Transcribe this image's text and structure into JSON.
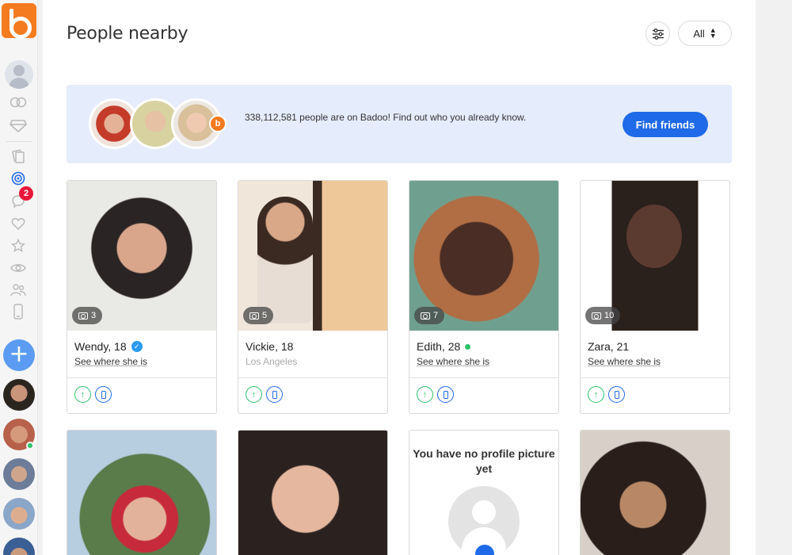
{
  "app": {
    "name": "Badoo"
  },
  "sidebar": {
    "icons": [
      "profile-avatar-icon",
      "encounters-icon",
      "premium-diamond-icon",
      "cards-icon",
      "people-nearby-icon",
      "messages-icon",
      "likes-icon",
      "favourites-icon",
      "visitors-icon",
      "friends-icon",
      "mobile-icon"
    ],
    "messages_badge": "2",
    "add_label": "+"
  },
  "header": {
    "title": "People nearby",
    "filter_label": "All"
  },
  "banner": {
    "text": "338,112,581 people are on Badoo! Find out who you already know.",
    "button": "Find friends"
  },
  "cards": [
    {
      "name": "Wendy, 18",
      "sub": "See where she is",
      "photos": "3",
      "verified": true,
      "online": false
    },
    {
      "name": "Vickie, 18",
      "sub": "Los Angeles",
      "photos": "5",
      "verified": false,
      "online": false
    },
    {
      "name": "Edith, 28",
      "sub": "See where she is",
      "photos": "7",
      "verified": false,
      "online": true
    },
    {
      "name": "Zara, 21",
      "sub": "See where she is",
      "photos": "10",
      "verified": false,
      "online": false
    }
  ],
  "no_profile": {
    "text": "You have no profile picture yet"
  },
  "colors": {
    "brand": "#f47b20",
    "accent": "#1f6ae8",
    "online": "#2bc26a",
    "badge": "#e8173b",
    "banner_bg": "#e5ecfb"
  }
}
